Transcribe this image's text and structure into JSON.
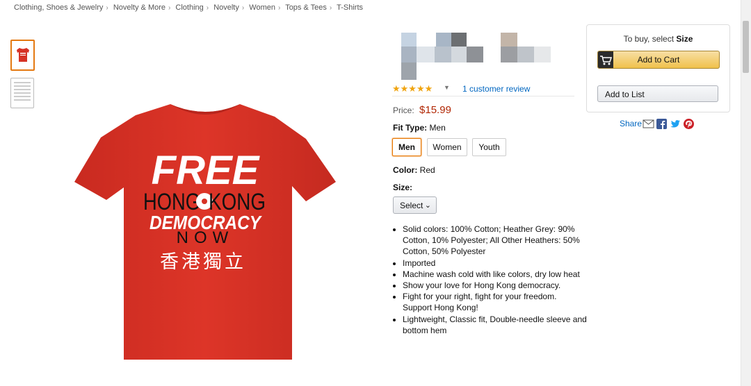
{
  "breadcrumb": [
    "Clothing, Shoes & Jewelry",
    "Novelty & More",
    "Clothing",
    "Novelty",
    "Women",
    "Tops & Tees",
    "T-Shirts"
  ],
  "product": {
    "shirt_color": "#d63226",
    "design": {
      "line1": "FREE",
      "line2a": "HONG",
      "line2b": "KONG",
      "line3": "DEMOCRACY",
      "line4": "NOW",
      "line5": "香港獨立"
    },
    "rating_stars": "★★★★★",
    "rating_value": 5,
    "reviews_link": "1 customer review",
    "price_label": "Price:",
    "price": "$15.99",
    "fit_label": "Fit Type:",
    "fit_value": "Men",
    "fit_options": [
      "Men",
      "Women",
      "Youth"
    ],
    "color_label": "Color:",
    "color_value": "Red",
    "size_label": "Size:",
    "size_select": "Select",
    "bullets": [
      "Solid colors: 100% Cotton; Heather Grey: 90% Cotton, 10% Polyester; All Other Heathers: 50% Cotton, 50% Polyester",
      "Imported",
      "Machine wash cold with like colors, dry low heat",
      "Show your love for Hong Kong democracy.",
      "Fight for your right, fight for your freedom. Support Hong Kong!",
      "Lightweight, Classic fit, Double-needle sleeve and bottom hem"
    ]
  },
  "buybox": {
    "caption_prefix": "To buy, select",
    "caption_bold": "Size",
    "add_to_cart": "Add to Cart",
    "add_to_list": "Add to List"
  },
  "share": {
    "label": "Share",
    "icons": [
      "email-icon",
      "facebook-icon",
      "twitter-icon",
      "pinterest-icon"
    ]
  },
  "colors": {
    "link": "#0066c0",
    "price": "#b12704",
    "accent": "#e77600",
    "star": "#f0a40f"
  }
}
